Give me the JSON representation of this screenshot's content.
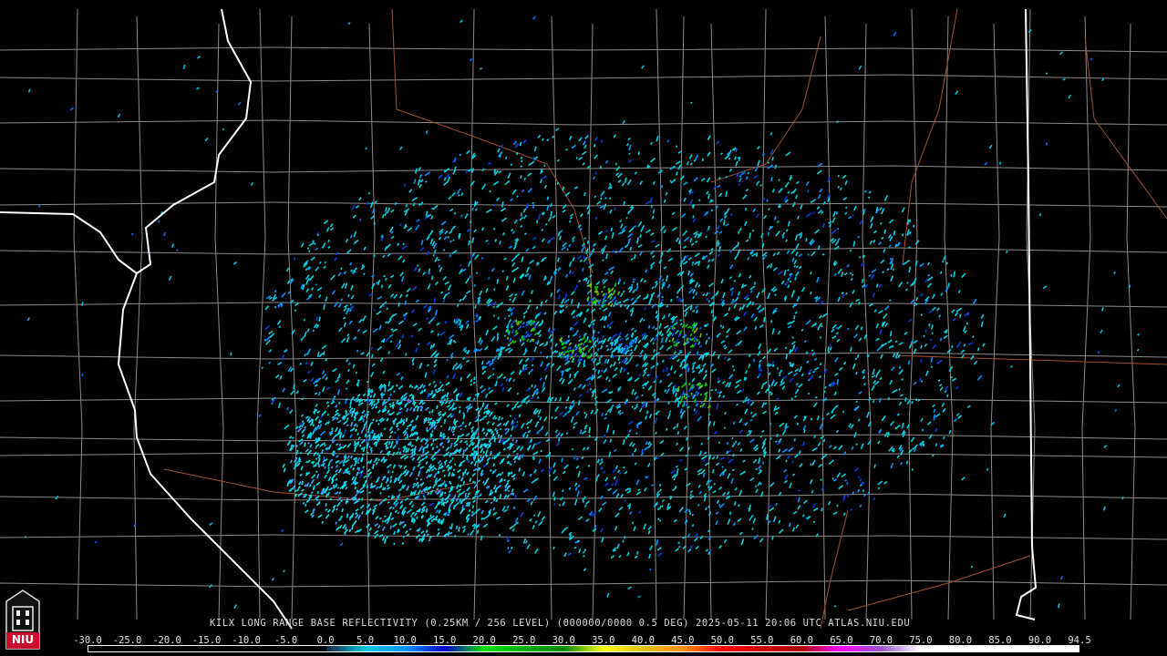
{
  "station_caption": "KILX LONG RANGE BASE REFLECTIVITY (0.25KM / 256 LEVEL) (000000/0000 0.5 DEG) 2025-05-11 20:06 UTC  ATLAS.NIU.EDU",
  "logo_text": "NIU",
  "scale": {
    "labels": [
      "-30.0",
      "-25.0",
      "-20.0",
      "-15.0",
      "-10.0",
      "-5.0",
      "0.0",
      "5.0",
      "10.0",
      "15.0",
      "20.0",
      "25.0",
      "30.0",
      "35.0",
      "40.0",
      "45.0",
      "50.0",
      "55.0",
      "60.0",
      "65.0",
      "70.0",
      "75.0",
      "80.0",
      "85.0",
      "90.0",
      "94.5"
    ],
    "colors": [
      "#000000",
      "#000000",
      "#000000",
      "#000000",
      "#000000",
      "#000000",
      "#1a2a3a",
      "#00c8e0",
      "#0096ff",
      "#0000d0",
      "#00e000",
      "#00b000",
      "#008800",
      "#ffff00",
      "#e0c000",
      "#ff9000",
      "#ff0000",
      "#d00000",
      "#b00000",
      "#ff00ff",
      "#9955cc",
      "#ffffff",
      "#ffffff",
      "#ffffff",
      "#ffffff"
    ]
  },
  "colors": {
    "background": "#000000",
    "county_lines": "#8a8a8a",
    "state_lines": "#ffffff",
    "highways": "#a0522d",
    "echo_light": "#00d8e8",
    "echo_mid": "#0096ff",
    "echo_strong": "#00c000"
  }
}
